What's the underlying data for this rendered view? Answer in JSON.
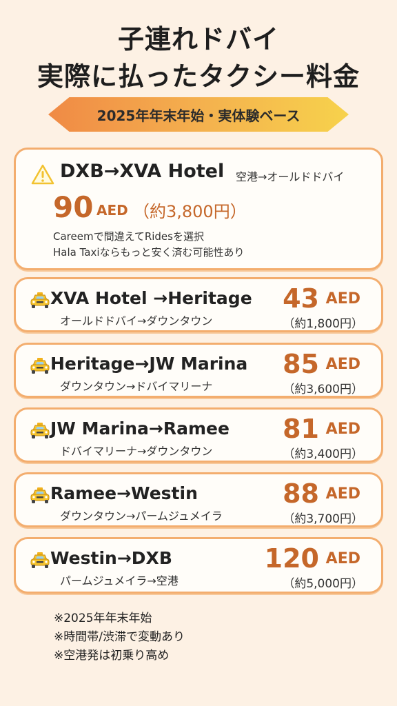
{
  "header": {
    "title_line1": "子連れドバイ",
    "title_line2": "実際に払ったタクシー料金",
    "ribbon": "2025年年末年始・実体験ベース"
  },
  "featured": {
    "icon": "warning-icon",
    "route": "DXB→XVA Hotel",
    "sub": "空港→オールドドバイ",
    "price": "90",
    "unit": "AED",
    "yen": "（約3,800円）",
    "note1": "Careemで間違えてRidesを選択",
    "note2": "Hala Taxiならもっと安く済む可能性あり"
  },
  "rides": [
    {
      "icon": "taxi-icon",
      "route": "XVA Hotel →Heritage",
      "sub": "オールドドバイ→ダウンタウン",
      "price": "43",
      "unit": "AED",
      "yen": "（約1,800円）"
    },
    {
      "icon": "taxi-icon",
      "route": "Heritage→JW Marina",
      "sub": "ダウンタウン→ドバイマリーナ",
      "price": "85",
      "unit": "AED",
      "yen": "（約3,600円）"
    },
    {
      "icon": "taxi-icon",
      "route": "JW Marina→Ramee",
      "sub": "ドバイマリーナ→ダウンタウン",
      "price": "81",
      "unit": "AED",
      "yen": "（約3,400円）"
    },
    {
      "icon": "taxi-icon",
      "route": "Ramee→Westin",
      "sub": "ダウンタウン→パームジュメイラ",
      "price": "88",
      "unit": "AED",
      "yen": "（約3,700円）"
    },
    {
      "icon": "taxi-icon",
      "route": "Westin→DXB",
      "sub": "パームジュメイラ→空港",
      "price": "120",
      "unit": "AED",
      "yen": "（約5,000円）"
    }
  ],
  "notes": [
    "※2025年年末年始",
    "※時間帯/渋滞で変動あり",
    "※空港発は初乗り高め"
  ],
  "colors": {
    "accent": "#c5672a",
    "card_border": "#f3ad6e",
    "background": "#fdf1e4",
    "ribbon_start": "#f08a45",
    "ribbon_end": "#f7d24c"
  }
}
